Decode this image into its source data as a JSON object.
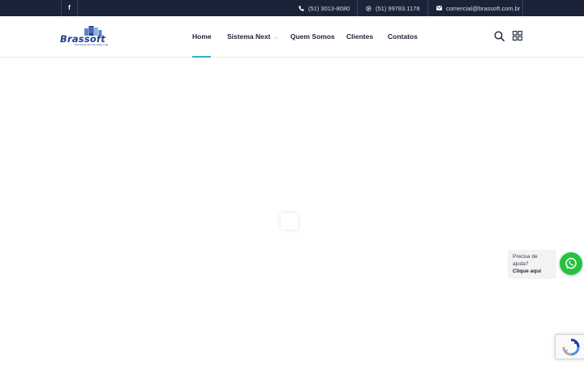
{
  "topbar": {
    "social_icon": "facebook-icon",
    "social_glyph": "f",
    "phone": "(51) 3013-8080",
    "whatsapp": "(51) 99783.1178",
    "email": "comercial@brassoft.com.br",
    "background": "#1b2338"
  },
  "logo": {
    "name": "Brassoft",
    "tagline": "Tecnologia da Informação Ltda"
  },
  "nav": {
    "items": [
      {
        "label": "Home",
        "active": true
      },
      {
        "label": "Sistema Next",
        "has_dropdown": true
      },
      {
        "label": "Quem Somos"
      },
      {
        "label": "Clientes"
      },
      {
        "label": "Contatos"
      }
    ],
    "accent": "#2bb4c7"
  },
  "header_icons": [
    "search-icon",
    "grid-menu-icon"
  ],
  "whatsapp_widget": {
    "line1": "Precisa de",
    "line2": "ajuda?",
    "cta": "Clique aqui",
    "color": "#25c23e"
  },
  "recaptcha": {
    "icon": "recaptcha-icon"
  }
}
